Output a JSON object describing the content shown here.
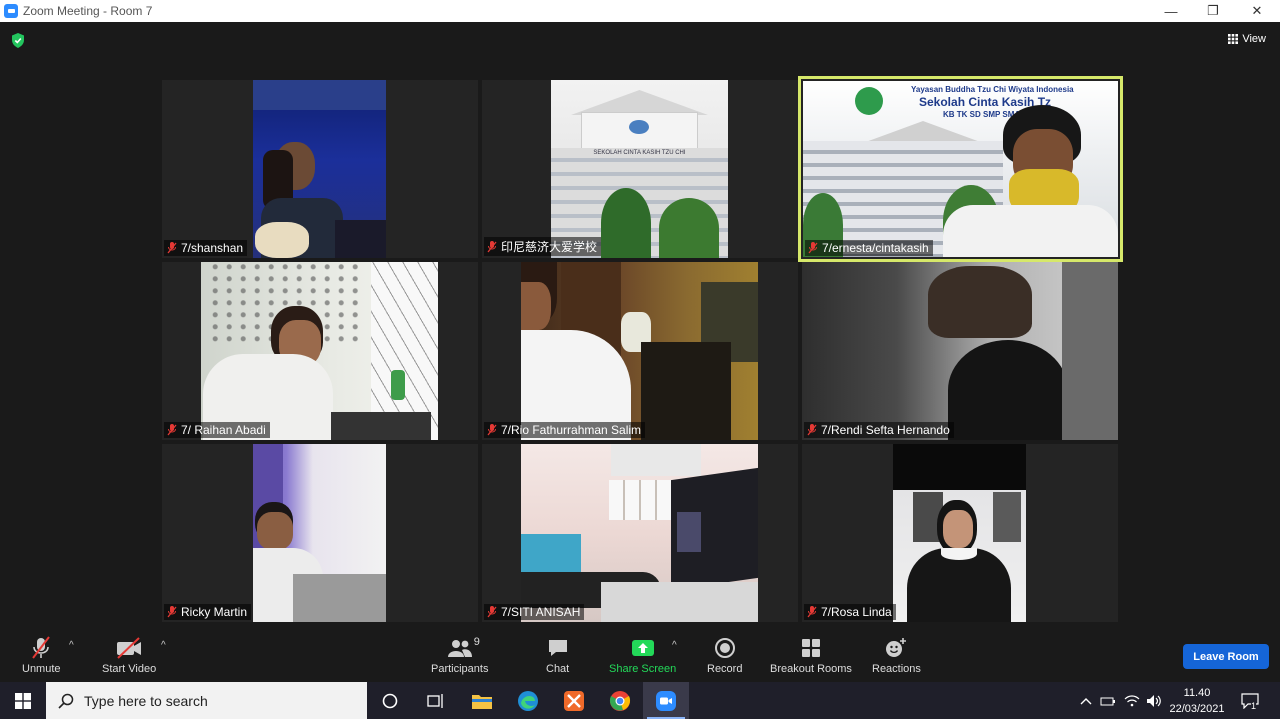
{
  "window": {
    "title": "Zoom Meeting - Room 7",
    "minimize": "—",
    "restore": "❐",
    "close": "✕"
  },
  "meeting": {
    "view_label": "View"
  },
  "participants": [
    {
      "name": "7/shanshan",
      "muted": true
    },
    {
      "name": "印尼慈济大爱学校",
      "muted": true
    },
    {
      "name": "7/ernesta/cintakasih",
      "muted": true,
      "active_speaker": true
    },
    {
      "name": "7/ Raihan Abadi",
      "muted": true
    },
    {
      "name": "7/Rio Fathurrahman Salim",
      "muted": true
    },
    {
      "name": "7/Rendi Sefta Hernando",
      "muted": true
    },
    {
      "name": "Ricky Martin",
      "muted": true
    },
    {
      "name": "7/SITI ANISAH",
      "muted": true
    },
    {
      "name": "7/Rosa Linda",
      "muted": true
    }
  ],
  "school_banner": {
    "line1": "Yayasan Buddha Tzu Chi Wiyata Indonesia",
    "line2": "Sekolah Cinta Kasih Tz",
    "line3": "KB TK SD SMP SMA",
    "building_sign": "SEKOLAH CINTA KASIH TZU CHI"
  },
  "toolbar": {
    "unmute": "Unmute",
    "start_video": "Start Video",
    "participants": "Participants",
    "participants_count": "9",
    "chat": "Chat",
    "share_screen": "Share Screen",
    "record": "Record",
    "breakout_rooms": "Breakout Rooms",
    "reactions": "Reactions",
    "leave_room": "Leave Room",
    "share_color": "#23d959",
    "leave_color": "#1565d8"
  },
  "taskbar": {
    "search_placeholder": "Type here to search",
    "time": "11.40",
    "date": "22/03/2021",
    "notification_count": "1"
  }
}
